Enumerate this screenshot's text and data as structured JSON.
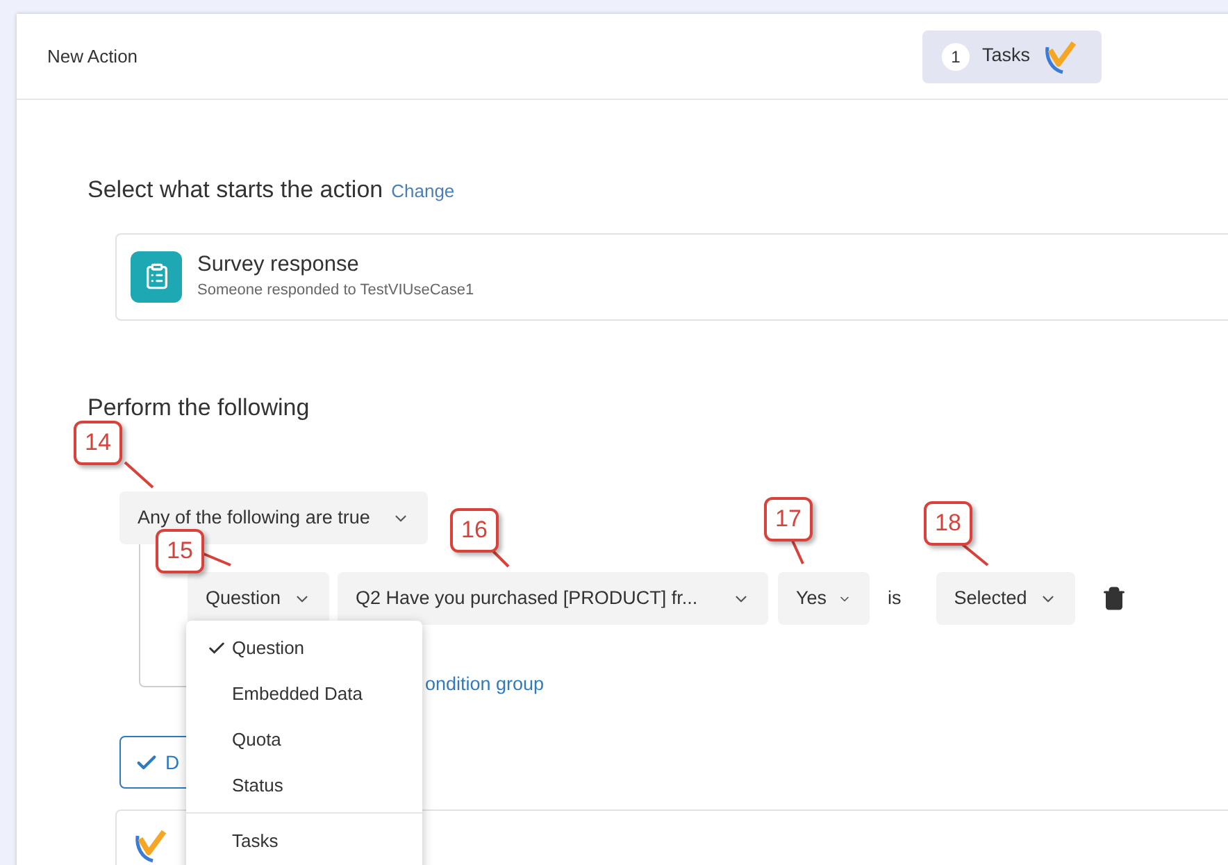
{
  "header": {
    "title": "New Action",
    "tasks": {
      "count": "1",
      "label": "Tasks"
    }
  },
  "trigger": {
    "heading": "Select what starts the action",
    "link": "Change",
    "card": {
      "title": "Survey response",
      "subtitle": "Someone responded to TestVIUseCase1"
    }
  },
  "perform": {
    "heading": "Perform the following",
    "group_condition": "Any of the following are true",
    "condition": {
      "type": "Question",
      "question": "Q2 Have you purchased [PRODUCT] fr...",
      "choice": "Yes",
      "operator": "is",
      "state": "Selected"
    },
    "add_link": "ondition group",
    "done_button": "D"
  },
  "type_menu": {
    "items": [
      {
        "label": "Question",
        "selected": true
      },
      {
        "label": "Embedded Data",
        "selected": false
      },
      {
        "label": "Quota",
        "selected": false
      },
      {
        "label": "Status",
        "selected": false
      }
    ],
    "extra_items": [
      {
        "label": "Tasks",
        "selected": false
      }
    ]
  },
  "callouts": [
    {
      "number": "14"
    },
    {
      "number": "15"
    },
    {
      "number": "16"
    },
    {
      "number": "17"
    },
    {
      "number": "18"
    }
  ]
}
